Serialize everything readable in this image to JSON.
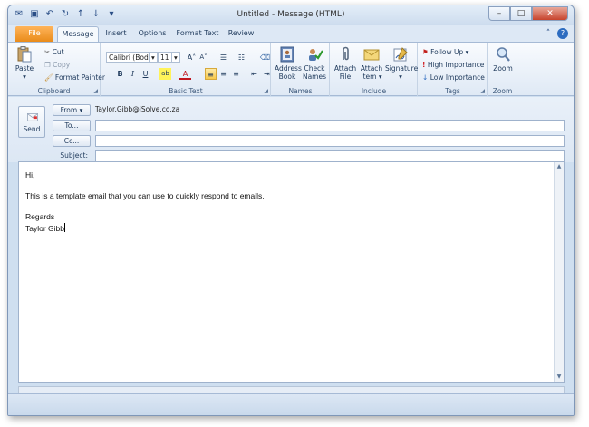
{
  "window": {
    "title": "Untitled - Message (HTML)",
    "minimize_glyph": "–",
    "maximize_glyph": "□",
    "close_glyph": "✕"
  },
  "qat": {
    "app_icon": "✉",
    "save_icon": "▣",
    "undo_icon": "↶",
    "redo_icon": "↻",
    "up_icon": "↑",
    "down_icon": "↓",
    "more_icon": "▾"
  },
  "tabs": [
    {
      "label": "File"
    },
    {
      "label": "Message"
    },
    {
      "label": "Insert"
    },
    {
      "label": "Options"
    },
    {
      "label": "Format Text"
    },
    {
      "label": "Review"
    }
  ],
  "ribbon": {
    "clipboard": {
      "label": "Clipboard",
      "paste": "Paste",
      "paste_arrow": "▾",
      "cut": "Cut",
      "copy": "Copy",
      "format_painter": "Format Painter"
    },
    "basic_text": {
      "label": "Basic Text",
      "font": "Calibri (Bod",
      "size": "11",
      "grow": "A˄",
      "shrink": "A˅",
      "bold": "B",
      "italic": "I",
      "underline": "U",
      "highlight": "ab",
      "font_color": "A"
    },
    "names": {
      "label": "Names",
      "address_book": [
        "Address",
        "Book"
      ],
      "check_names": [
        "Check",
        "Names"
      ]
    },
    "include": {
      "label": "Include",
      "attach_file": [
        "Attach",
        "File"
      ],
      "attach_item": [
        "Attach",
        "Item ▾"
      ],
      "signature": [
        "Signature",
        "▾"
      ]
    },
    "tags": {
      "label": "Tags",
      "follow_up": "Follow Up ▾",
      "high_importance": "High Importance",
      "low_importance": "Low Importance"
    },
    "zoom": {
      "label": "Zoom",
      "zoom": "Zoom"
    }
  },
  "header": {
    "send": "Send",
    "from_button": "From ▾",
    "from_address": "Taylor.Gibb@iSolve.co.za",
    "to_button": "To...",
    "cc_button": "Cc...",
    "subject_label": "Subject:",
    "to_value": "",
    "cc_value": "",
    "subject_value": ""
  },
  "body": {
    "greeting": "Hi,",
    "line1": "This is a template email that you can use to quickly respond to emails.",
    "closing": "Regards",
    "signature": "Taylor Gibb"
  },
  "colors": {
    "file_tab": "#e98b1a",
    "ribbon": "#dfe9f5",
    "accent": "#2d6cc0"
  }
}
